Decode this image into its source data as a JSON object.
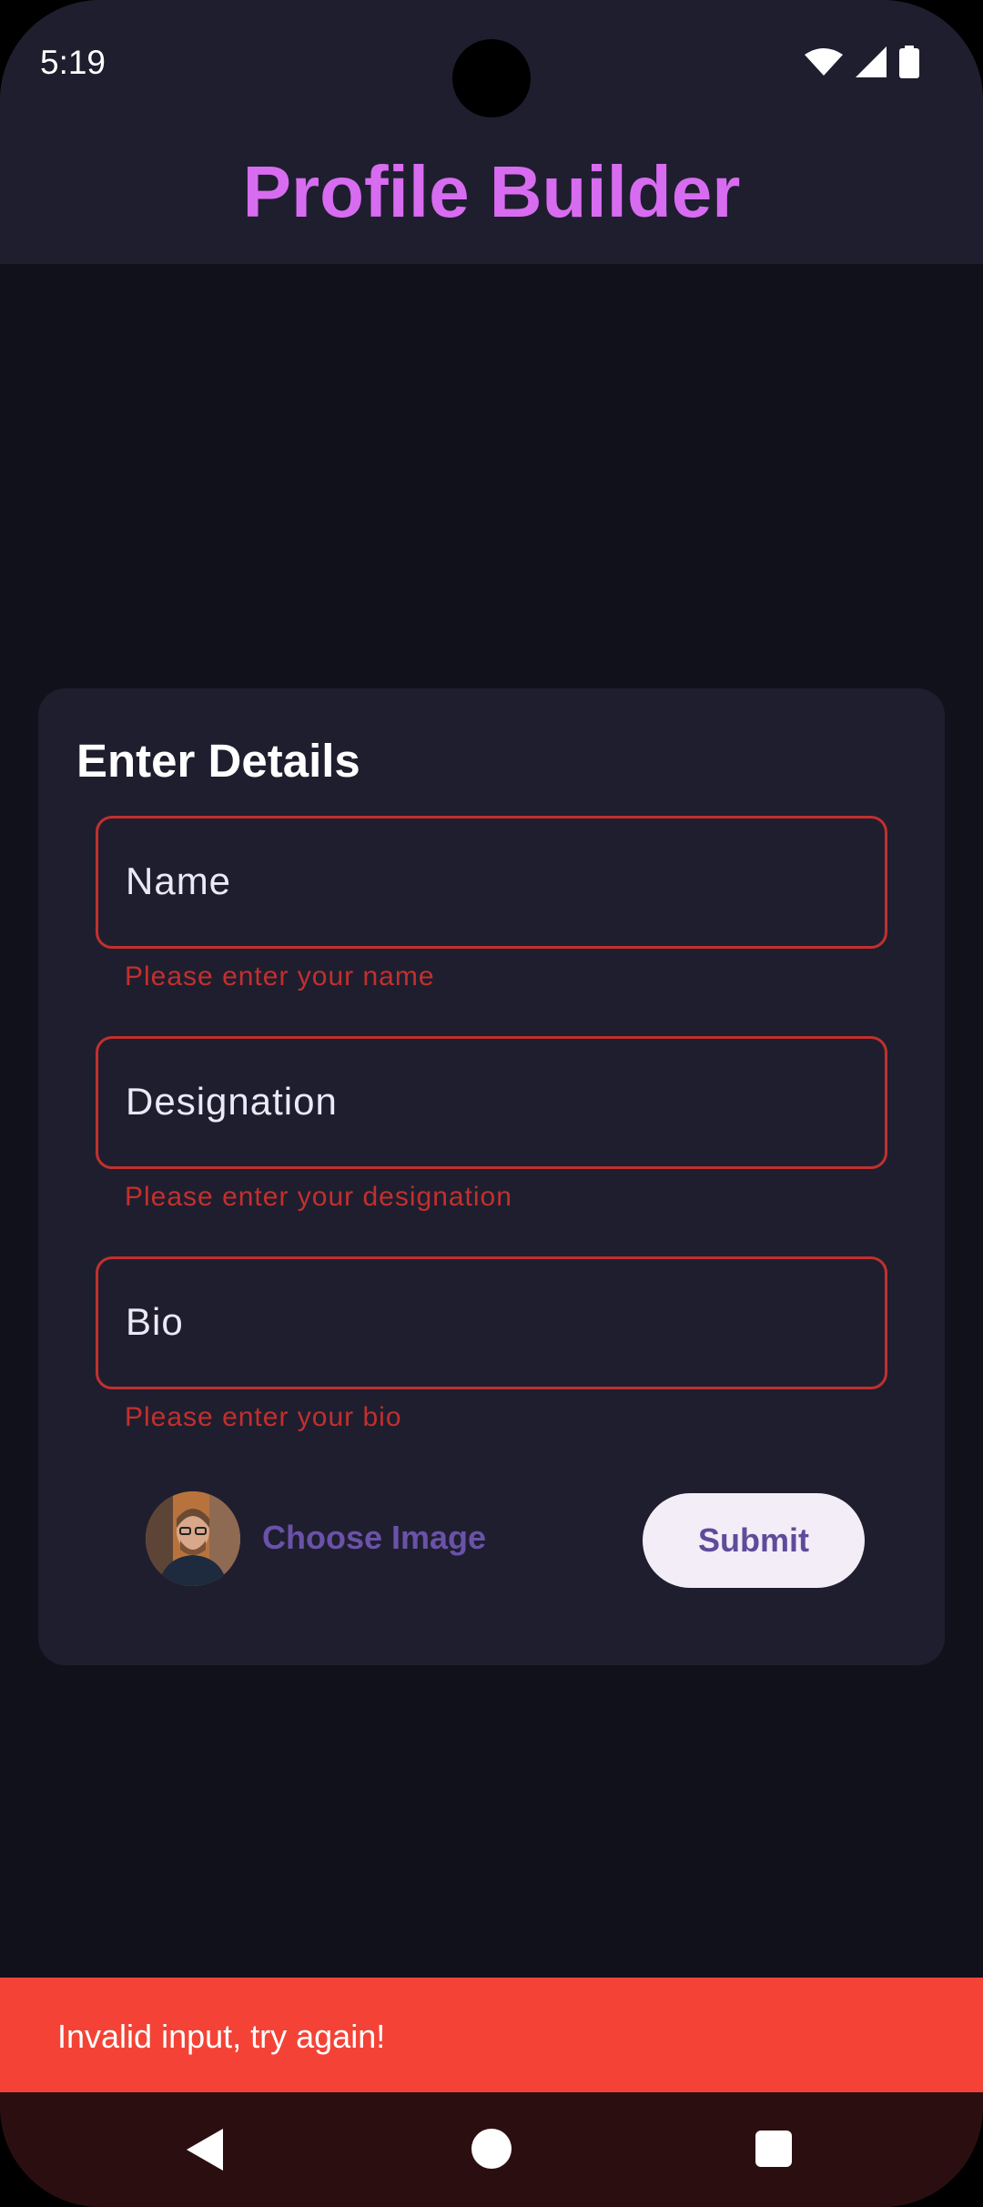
{
  "status": {
    "time": "5:19",
    "icons": [
      "wifi-icon",
      "signal-icon",
      "battery-icon"
    ]
  },
  "app": {
    "title": "Profile Builder",
    "title_color": "#d86cf0"
  },
  "form": {
    "title": "Enter Details",
    "fields": [
      {
        "label": "Name",
        "error": "Please enter your name"
      },
      {
        "label": "Designation",
        "error": "Please enter your designation"
      },
      {
        "label": "Bio",
        "error": "Please enter your bio"
      }
    ],
    "choose_image_label": "Choose Image",
    "submit_label": "Submit",
    "error_color": "#c2302d"
  },
  "snackbar": {
    "message": "Invalid input, try again!",
    "color": "#f44336"
  },
  "nav": {
    "icons": [
      "back-icon",
      "home-icon",
      "recents-icon"
    ]
  }
}
